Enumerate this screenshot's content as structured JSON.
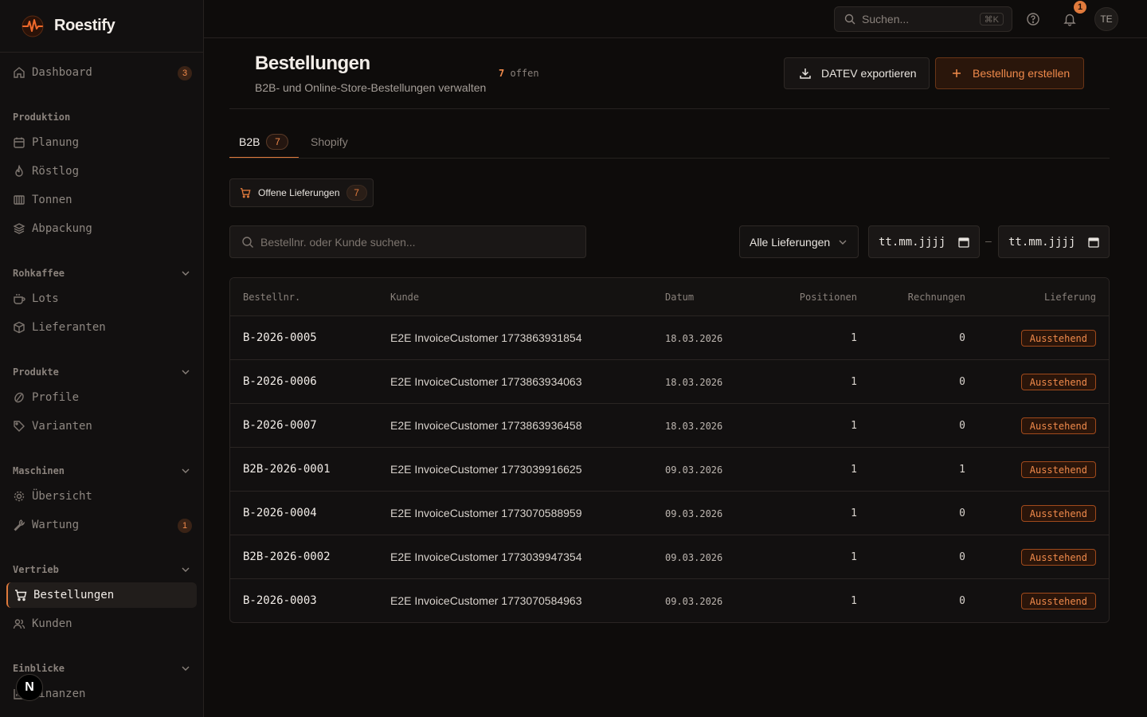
{
  "app": {
    "name": "Roestify"
  },
  "sidebar": {
    "dashboard": {
      "label": "Dashboard",
      "badge": "3"
    },
    "sections": [
      {
        "title": "Produktion",
        "collapsible": false,
        "items": [
          "Planung",
          "Röstlog",
          "Tonnen",
          "Abpackung"
        ]
      },
      {
        "title": "Rohkaffee",
        "collapsible": true,
        "items": [
          "Lots",
          "Lieferanten"
        ]
      },
      {
        "title": "Produkte",
        "collapsible": true,
        "items": [
          "Profile",
          "Varianten"
        ]
      },
      {
        "title": "Maschinen",
        "collapsible": true,
        "items": [
          "Übersicht",
          "Wartung"
        ],
        "wartung_badge": "1"
      },
      {
        "title": "Vertrieb",
        "collapsible": true,
        "items": [
          "Bestellungen",
          "Kunden"
        ]
      },
      {
        "title": "Einblicke",
        "collapsible": true,
        "items": [
          "Finanzen"
        ]
      }
    ],
    "floating_badge": "N"
  },
  "topbar": {
    "search_placeholder": "Suchen...",
    "shortcut": "⌘K",
    "notification_count": "1",
    "avatar_initials": "TE"
  },
  "page": {
    "title": "Bestellungen",
    "subtitle": "B2B- und Online-Store-Bestellungen verwalten",
    "open_count": "7",
    "open_label": "offen",
    "export_button": "DATEV exportieren",
    "create_button": "Bestellung erstellen"
  },
  "tabs": [
    {
      "label": "B2B",
      "count": "7",
      "active": true
    },
    {
      "label": "Shopify",
      "active": false
    }
  ],
  "filter_chip": {
    "label": "Offene Lieferungen",
    "count": "7"
  },
  "filters": {
    "search_placeholder": "Bestellnr. oder Kunde suchen...",
    "delivery_select": "Alle Lieferungen",
    "date_from_placeholder": "tt.mm.jjjj",
    "date_to_placeholder": "tt.mm.jjjj",
    "date_separator": "–"
  },
  "table": {
    "columns": [
      "Bestellnr.",
      "Kunde",
      "Datum",
      "Positionen",
      "Rechnungen",
      "Lieferung"
    ],
    "rows": [
      {
        "id": "B-2026-0005",
        "customer": "E2E InvoiceCustomer 1773863931854",
        "date": "18.03.2026",
        "positions": "1",
        "invoices": "0",
        "status": "Ausstehend"
      },
      {
        "id": "B-2026-0006",
        "customer": "E2E InvoiceCustomer 1773863934063",
        "date": "18.03.2026",
        "positions": "1",
        "invoices": "0",
        "status": "Ausstehend"
      },
      {
        "id": "B-2026-0007",
        "customer": "E2E InvoiceCustomer 1773863936458",
        "date": "18.03.2026",
        "positions": "1",
        "invoices": "0",
        "status": "Ausstehend"
      },
      {
        "id": "B2B-2026-0001",
        "customer": "E2E InvoiceCustomer 1773039916625",
        "date": "09.03.2026",
        "positions": "1",
        "invoices": "1",
        "status": "Ausstehend"
      },
      {
        "id": "B-2026-0004",
        "customer": "E2E InvoiceCustomer 1773070588959",
        "date": "09.03.2026",
        "positions": "1",
        "invoices": "0",
        "status": "Ausstehend"
      },
      {
        "id": "B2B-2026-0002",
        "customer": "E2E InvoiceCustomer 1773039947354",
        "date": "09.03.2026",
        "positions": "1",
        "invoices": "0",
        "status": "Ausstehend"
      },
      {
        "id": "B-2026-0003",
        "customer": "E2E InvoiceCustomer 1773070584963",
        "date": "09.03.2026",
        "positions": "1",
        "invoices": "0",
        "status": "Ausstehend"
      }
    ]
  },
  "colors": {
    "accent": "#e07a3c",
    "background": "#0e0c0b",
    "sidebar": "#121010"
  }
}
